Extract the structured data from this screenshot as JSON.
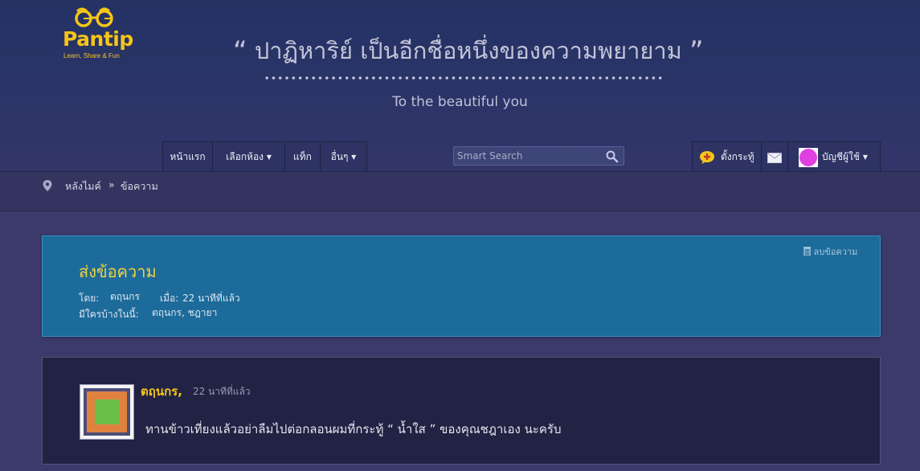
{
  "logo": {
    "name": "Pantip",
    "tagline": "Learn, Share & Fun"
  },
  "banner": {
    "quote": "ปาฏิหาริย์ เป็นอีกชื่อหนึ่งของความพยายาม",
    "open_quote": "“",
    "close_quote": "”",
    "subtitle": "To the beautiful you"
  },
  "nav": {
    "items": [
      {
        "label": "หน้าแรก"
      },
      {
        "label": "เลือกห้อง ▾"
      },
      {
        "label": "แท็ก"
      },
      {
        "label": "อื่นๆ ▾"
      }
    ],
    "search_placeholder": "Smart Search",
    "post_label": "ตั้งกระทู้",
    "account_label": "บัญชีผู้ใช้ ▾"
  },
  "breadcrumb": {
    "root": "หลังไมค์",
    "separator": "»",
    "current": "ข้อความ"
  },
  "topic": {
    "title": "ส่งข้อความ",
    "delete_label": "ลบข้อความ",
    "by_label": "โดย:",
    "author": "ตฤนกร",
    "when_label": "เมื่อ:",
    "when_value": "22 นาทีที่แล้ว",
    "participants_label": "มีใครบ้างในนี้:",
    "participants": "ตฤนกร,  ชฎายา"
  },
  "comment": {
    "author": "ตฤนกร,",
    "time": "22 นาทีที่แล้ว",
    "body": "ทานข้าวเที่ยงแล้วอย่าลืมไปต่อกลอนผมที่กระทู้ “ น้ำใส ” ของคุณชฎาเอง  นะครับ"
  },
  "colors": {
    "accent_yellow": "#f3d23a",
    "topic_bg": "#1d6b9a",
    "page_bg": "#3c3a6a",
    "avatar_pink": "#e040e0"
  },
  "icons": [
    "glasses-logo-icon",
    "search-icon",
    "map-pin-icon",
    "trash-icon",
    "new-post-bubble-icon",
    "mail-icon",
    "avatar-icon"
  ]
}
